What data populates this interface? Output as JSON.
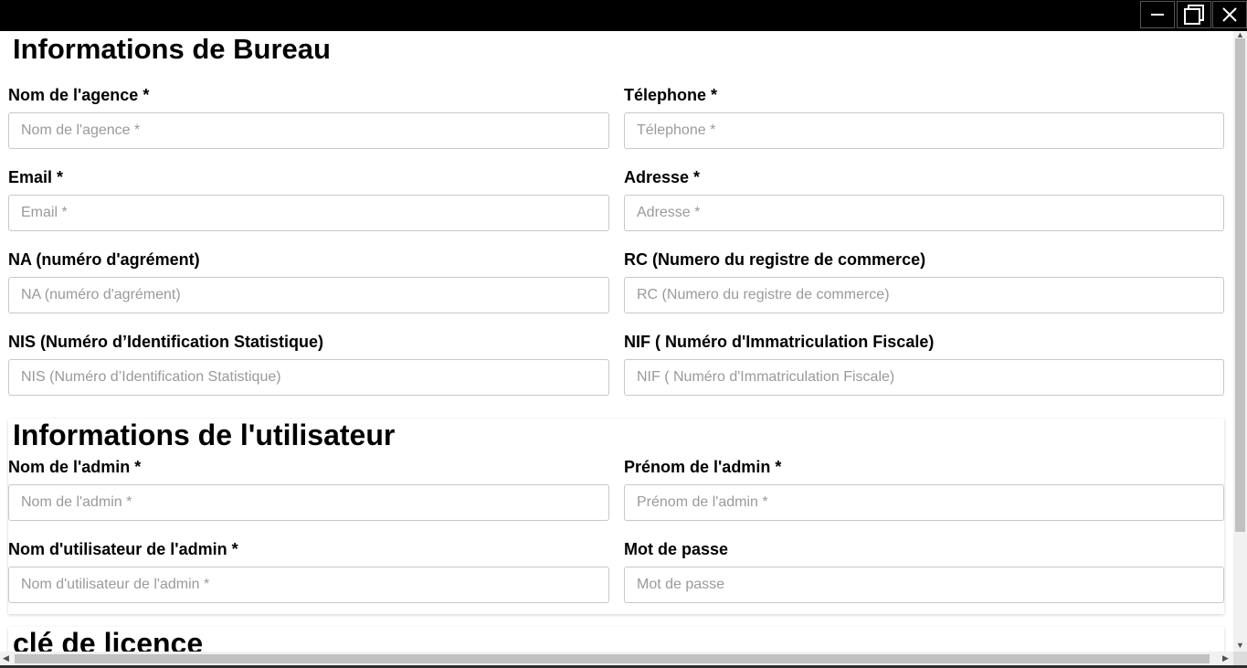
{
  "window": {
    "minimize_icon": "minimize-icon",
    "maximize_icon": "maximize-icon",
    "close_icon": "close-icon"
  },
  "bureau": {
    "title": "Informations de Bureau",
    "fields": {
      "agence": {
        "label": "Nom de l'agence *",
        "placeholder": "Nom de l'agence *"
      },
      "telephone": {
        "label": "Télephone *",
        "placeholder": "Télephone *"
      },
      "email": {
        "label": "Email *",
        "placeholder": "Email *"
      },
      "adresse": {
        "label": "Adresse *",
        "placeholder": "Adresse *"
      },
      "na": {
        "label": "NA (numéro d'agrément)",
        "placeholder": "NA (numéro d'agrément)"
      },
      "rc": {
        "label": "RC (Numero du registre de commerce)",
        "placeholder": "RC (Numero du registre de commerce)"
      },
      "nis": {
        "label": "NIS (Numéro d’Identification Statistique)",
        "placeholder": "NIS (Numéro d’Identification Statistique)"
      },
      "nif": {
        "label": "NIF ( Numéro d'Immatriculation Fiscale)",
        "placeholder": "NIF ( Numéro d'Immatriculation Fiscale)"
      }
    }
  },
  "utilisateur": {
    "title": "Informations de l'utilisateur",
    "fields": {
      "nom_admin": {
        "label": "Nom de l'admin *",
        "placeholder": "Nom de l'admin *"
      },
      "prenom_admin": {
        "label": "Prénom de l'admin *",
        "placeholder": "Prénom de l'admin *"
      },
      "username_admin": {
        "label": "Nom d'utilisateur de l'admin *",
        "placeholder": "Nom d'utilisateur de l'admin *"
      },
      "password": {
        "label": "Mot de passe",
        "placeholder": "Mot de passe"
      }
    }
  },
  "licence": {
    "title": "clé de licence"
  },
  "scrollbars": {
    "up_arrow": "▲",
    "down_arrow": "▼",
    "left_arrow": "◀",
    "right_arrow": "▶"
  }
}
